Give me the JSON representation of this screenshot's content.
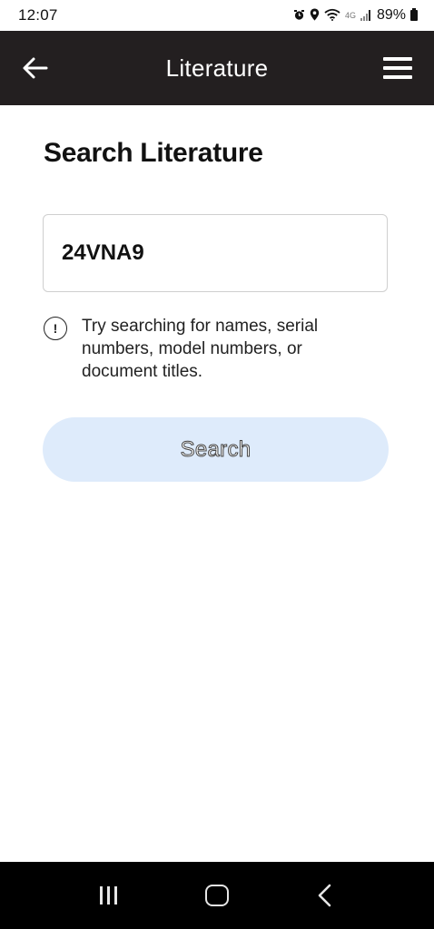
{
  "status_bar": {
    "time": "12:07",
    "network_label": "4G",
    "battery_percent": "89%",
    "icons": [
      "alarm-icon",
      "location-icon",
      "wifi-icon",
      "signal-icon",
      "battery-icon"
    ]
  },
  "app_bar": {
    "title": "Literature",
    "back_icon": "arrow-left-icon",
    "menu_icon": "hamburger-menu-icon"
  },
  "main": {
    "heading": "Search Literature",
    "search": {
      "value": "24VNA9",
      "placeholder": ""
    },
    "hint_icon": "info-icon",
    "hint_glyph": "!",
    "hint_text": "Try searching for names, serial numbers, model numbers, or document titles.",
    "search_button_label": "Search"
  },
  "nav_bar": {
    "buttons": [
      "recents-icon",
      "home-icon",
      "back-icon"
    ]
  },
  "colors": {
    "app_bar_bg": "#231f20",
    "search_button_bg": "#deebfb",
    "nav_bar_bg": "#000000"
  }
}
